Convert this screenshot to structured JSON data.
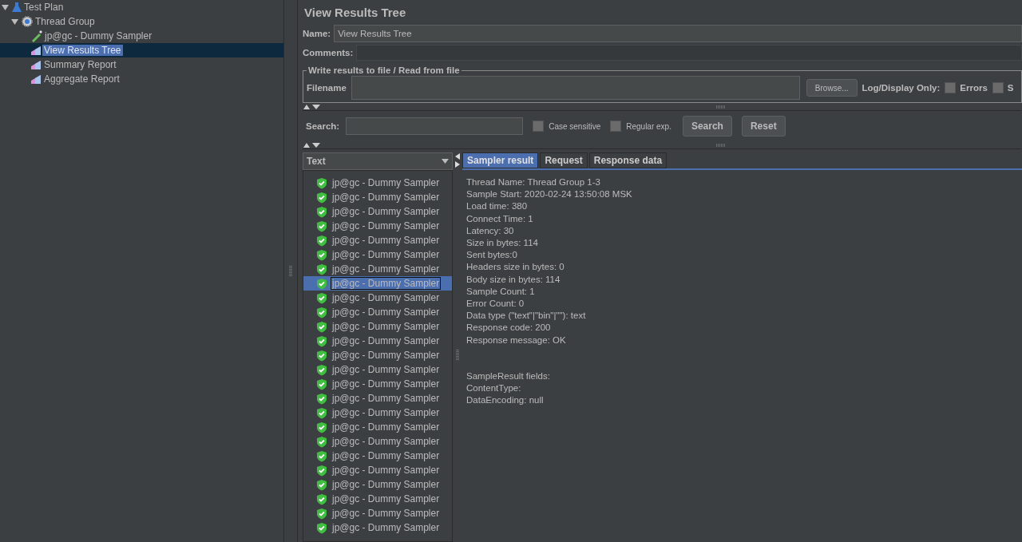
{
  "tree": [
    {
      "label": "Test Plan",
      "kind": "plan",
      "expanded": true,
      "selected": false,
      "children": [
        {
          "label": "Thread Group",
          "kind": "group",
          "expanded": true,
          "selected": false,
          "children": [
            {
              "label": "jp@gc - Dummy Sampler",
              "kind": "sampler",
              "selected": false
            },
            {
              "label": "View Results Tree",
              "kind": "listener",
              "selected": true
            },
            {
              "label": "Summary Report",
              "kind": "listener",
              "selected": false
            },
            {
              "label": "Aggregate Report",
              "kind": "listener",
              "selected": false
            }
          ]
        }
      ]
    }
  ],
  "panel": {
    "title": "View Results Tree",
    "name_label": "Name:",
    "name_value": "View Results Tree",
    "comments_label": "Comments:",
    "file_group": {
      "legend": "Write results to file / Read from file",
      "filename_label": "Filename",
      "browse": "Browse...",
      "log_label": "Log/Display Only:",
      "options": [
        {
          "label": "Errors",
          "checked": false
        },
        {
          "label": "S",
          "checked": false
        }
      ]
    },
    "search": {
      "label": "Search:",
      "options": [
        {
          "label": "Case sensitive",
          "checked": false
        },
        {
          "label": "Regular exp.",
          "checked": false
        }
      ],
      "buttons": [
        "Search",
        "Reset"
      ]
    },
    "renderer": "Text",
    "results": [
      {
        "label": "jp@gc - Dummy Sampler",
        "selected": false
      },
      {
        "label": "jp@gc - Dummy Sampler",
        "selected": false
      },
      {
        "label": "jp@gc - Dummy Sampler",
        "selected": false
      },
      {
        "label": "jp@gc - Dummy Sampler",
        "selected": false
      },
      {
        "label": "jp@gc - Dummy Sampler",
        "selected": false
      },
      {
        "label": "jp@gc - Dummy Sampler",
        "selected": false
      },
      {
        "label": "jp@gc - Dummy Sampler",
        "selected": false
      },
      {
        "label": "jp@gc - Dummy Sampler",
        "selected": true
      },
      {
        "label": "jp@gc - Dummy Sampler",
        "selected": false
      },
      {
        "label": "jp@gc - Dummy Sampler",
        "selected": false
      },
      {
        "label": "jp@gc - Dummy Sampler",
        "selected": false
      },
      {
        "label": "jp@gc - Dummy Sampler",
        "selected": false
      },
      {
        "label": "jp@gc - Dummy Sampler",
        "selected": false
      },
      {
        "label": "jp@gc - Dummy Sampler",
        "selected": false
      },
      {
        "label": "jp@gc - Dummy Sampler",
        "selected": false
      },
      {
        "label": "jp@gc - Dummy Sampler",
        "selected": false
      },
      {
        "label": "jp@gc - Dummy Sampler",
        "selected": false
      },
      {
        "label": "jp@gc - Dummy Sampler",
        "selected": false
      },
      {
        "label": "jp@gc - Dummy Sampler",
        "selected": false
      },
      {
        "label": "jp@gc - Dummy Sampler",
        "selected": false
      },
      {
        "label": "jp@gc - Dummy Sampler",
        "selected": false
      },
      {
        "label": "jp@gc - Dummy Sampler",
        "selected": false
      },
      {
        "label": "jp@gc - Dummy Sampler",
        "selected": false
      },
      {
        "label": "jp@gc - Dummy Sampler",
        "selected": false
      },
      {
        "label": "jp@gc - Dummy Sampler",
        "selected": false
      }
    ],
    "tabs": [
      {
        "label": "Sampler result",
        "selected": true
      },
      {
        "label": "Request",
        "selected": false
      },
      {
        "label": "Response data",
        "selected": false
      }
    ],
    "details": [
      [
        "Thread Name: Thread Group 1-3",
        "Sample Start: 2020-02-24 13:50:08 MSK",
        "Load time: 380",
        "Connect Time: 1",
        "Latency: 30",
        "Size in bytes: 114",
        "Sent bytes:0",
        "Headers size in bytes: 0",
        "Body size in bytes: 114",
        "Sample Count: 1",
        "Error Count: 0",
        "Data type (\"text\"|\"bin\"|\"\"): text",
        "Response code: 200",
        "Response message: OK"
      ],
      [
        "SampleResult fields:",
        "ContentType:",
        "DataEncoding: null"
      ]
    ]
  }
}
